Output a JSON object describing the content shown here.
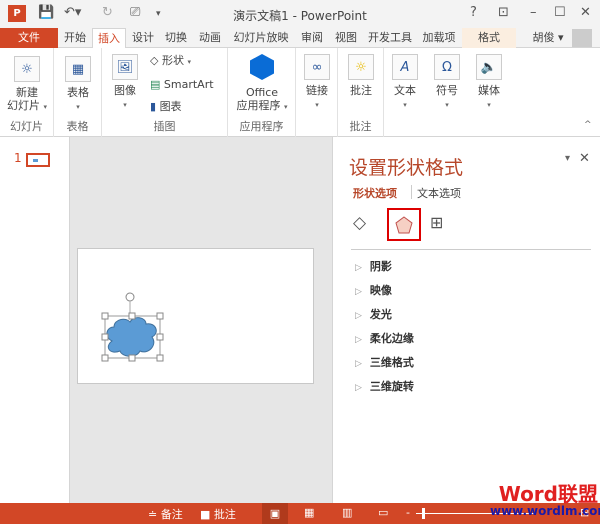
{
  "window": {
    "title": "演示文稿1 - PowerPoint",
    "help": "?",
    "user": "胡俊"
  },
  "tabs": [
    "文件",
    "开始",
    "插入",
    "设计",
    "切换",
    "动画",
    "幻灯片放映",
    "审阅",
    "视图",
    "开发工具",
    "加载项",
    "格式"
  ],
  "ribbon": {
    "new_slide": "新建\n幻灯片",
    "table": "表格",
    "images": "图像",
    "shapes": "形状",
    "smartart": "SmartArt",
    "chart": "图表",
    "office_apps_1": "Office",
    "office_apps_2": "应用程序",
    "links": "链接",
    "comment": "批注",
    "text": "文本",
    "symbols": "符号",
    "media": "媒体",
    "groups": {
      "slides": "幻灯片",
      "tables": "表格",
      "illustrations": "插图",
      "apps": "应用程序",
      "comments": "批注"
    }
  },
  "thumbs": {
    "slide_number": "1"
  },
  "pane": {
    "title": "设置形状格式",
    "tab_shape": "形状选项",
    "tab_text": "文本选项",
    "sections": [
      "阴影",
      "映像",
      "发光",
      "柔化边缘",
      "三维格式",
      "三维旋转"
    ]
  },
  "status": {
    "notes": "备注",
    "comments": "批注"
  },
  "watermark": {
    "brand": "Word联盟",
    "url": "www.wordlm.com"
  },
  "colors": {
    "accent": "#d24726",
    "shape_fill": "#5b9bd5"
  }
}
